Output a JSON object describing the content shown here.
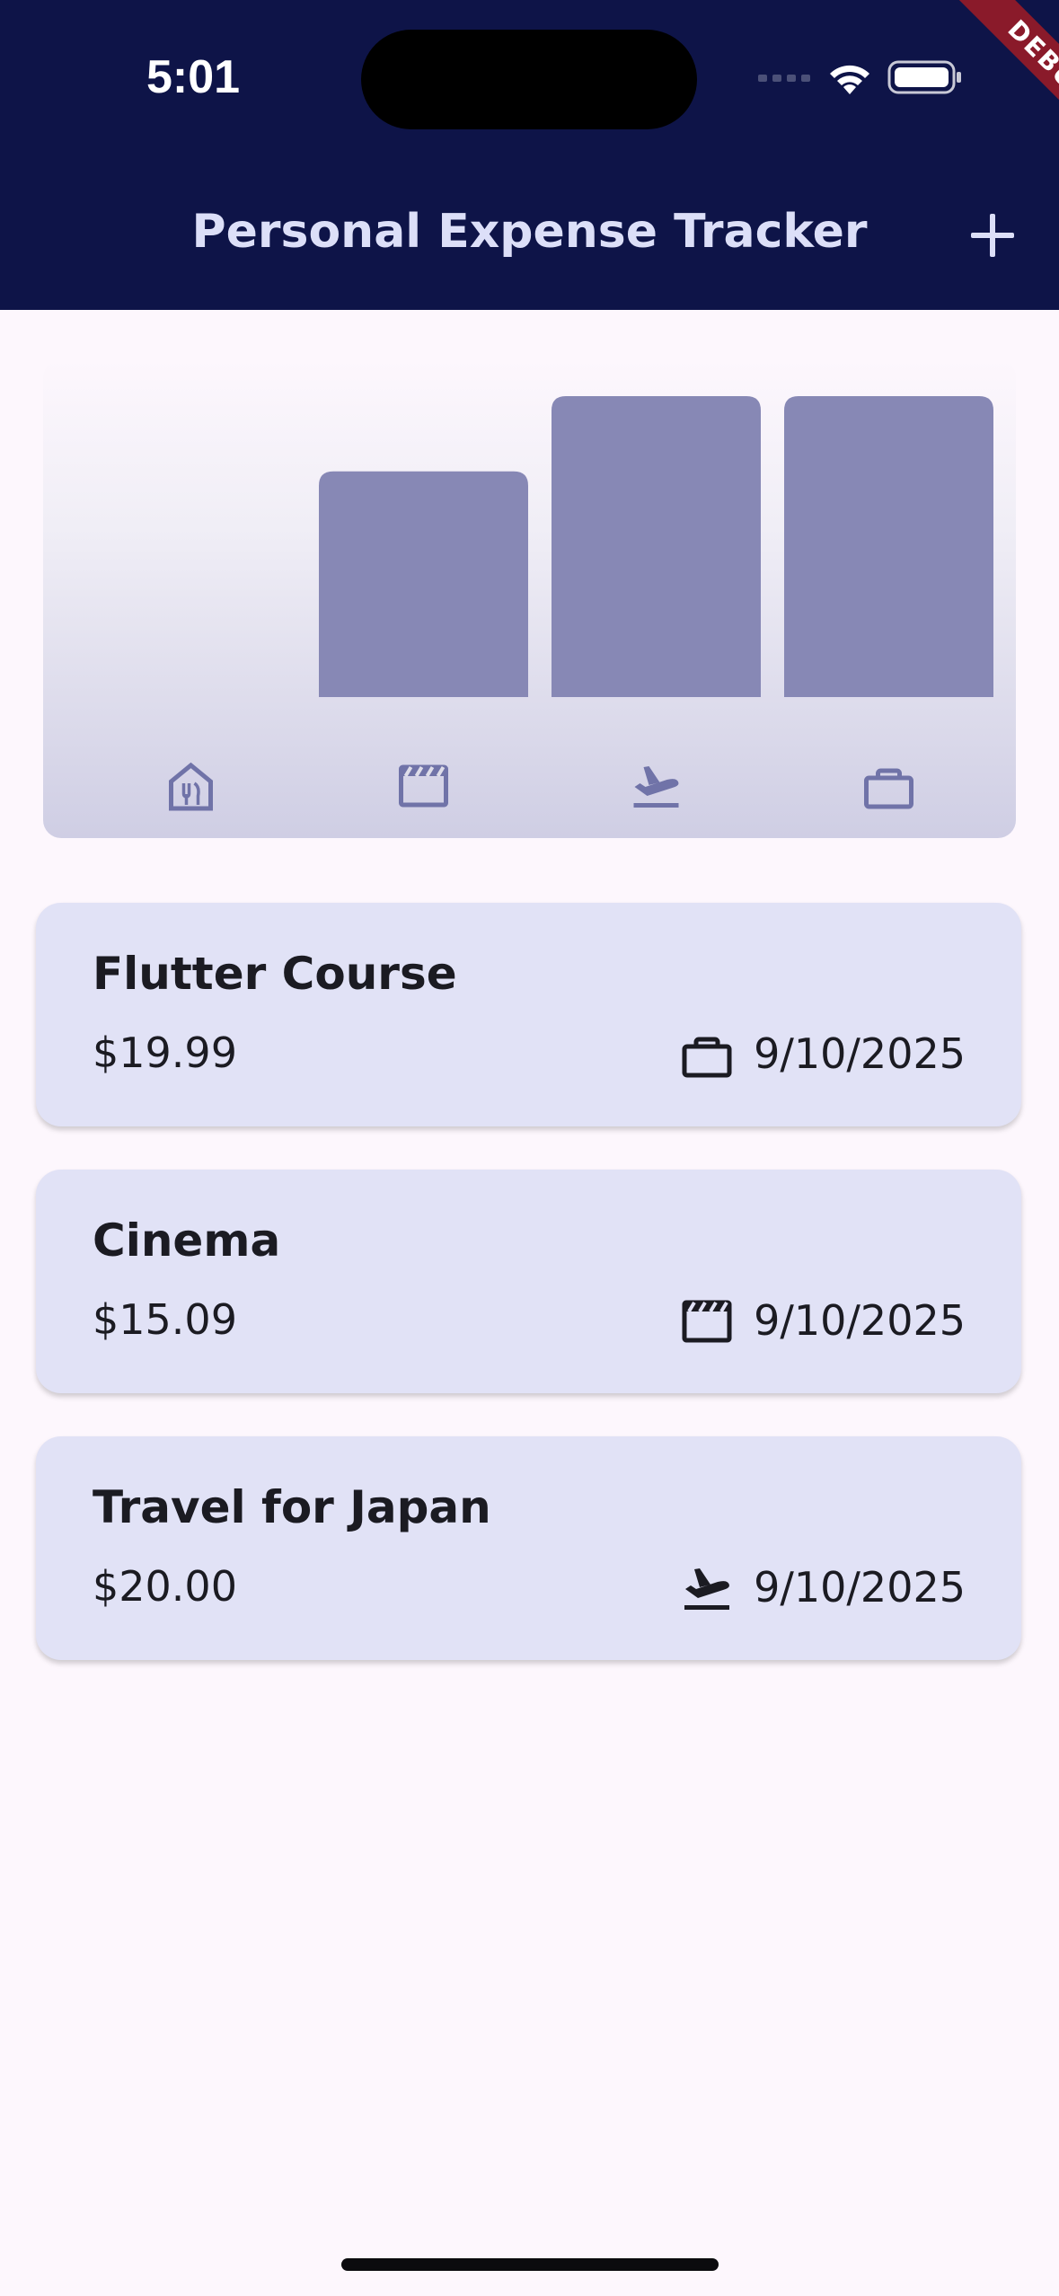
{
  "status_bar": {
    "time": "5:01",
    "debug_label": "DEBUG"
  },
  "app_bar": {
    "title": "Personal Expense Tracker",
    "add_icon": "plus-icon"
  },
  "chart_data": {
    "type": "bar",
    "categories": [
      "food",
      "leisure",
      "travel",
      "work"
    ],
    "category_icons": [
      "food-icon",
      "leisure-icon",
      "travel-icon",
      "work-icon"
    ],
    "values": [
      0,
      15.09,
      20.0,
      19.99
    ],
    "normalized_fill": [
      0,
      0.75,
      1.0,
      1.0
    ],
    "title": "",
    "xlabel": "",
    "ylabel": "",
    "grid": false,
    "legend": "none",
    "colors": {
      "bar": "#8788b5",
      "icon": "#7073a8"
    }
  },
  "expenses": [
    {
      "title": "Flutter Course",
      "amount": "$19.99",
      "date": "9/10/2025",
      "category_icon": "work-icon"
    },
    {
      "title": "Cinema",
      "amount": "$15.09",
      "date": "9/10/2025",
      "category_icon": "leisure-icon"
    },
    {
      "title": "Travel for Japan",
      "amount": "$20.00",
      "date": "9/10/2025",
      "category_icon": "travel-icon"
    }
  ],
  "colors": {
    "app_bar": "#0e1448",
    "card": "#e1e2f6",
    "background": "#fdf7fd"
  }
}
